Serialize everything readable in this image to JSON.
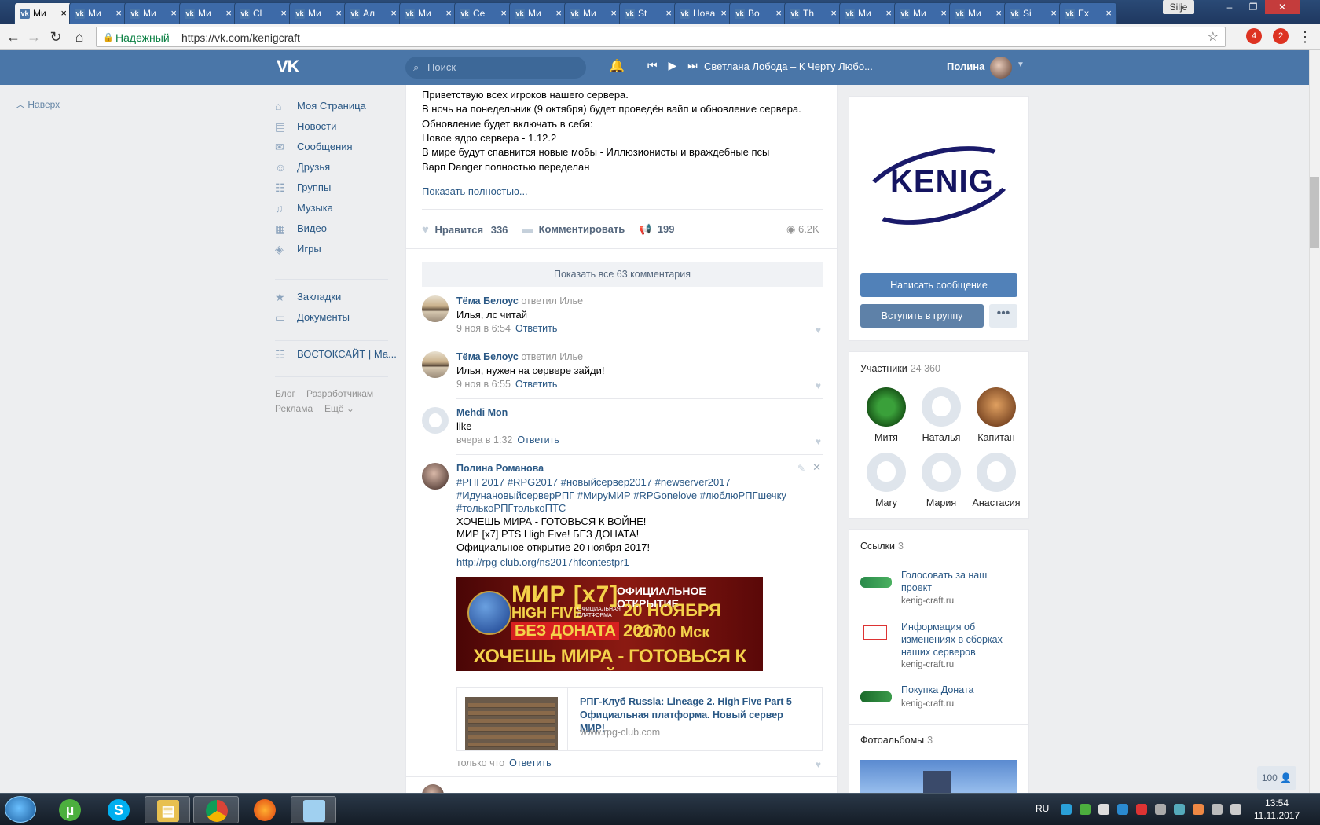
{
  "browser": {
    "tabs": [
      {
        "title": "Ми",
        "active": true
      },
      {
        "title": "Ми"
      },
      {
        "title": "Ми"
      },
      {
        "title": "Ми"
      },
      {
        "title": "Cl"
      },
      {
        "title": "Ми"
      },
      {
        "title": "Ал"
      },
      {
        "title": "Ми"
      },
      {
        "title": "Се"
      },
      {
        "title": "Ми"
      },
      {
        "title": "Ми"
      },
      {
        "title": "St"
      },
      {
        "title": "Новая"
      },
      {
        "title": "Во"
      },
      {
        "title": "Th"
      },
      {
        "title": "Ми"
      },
      {
        "title": "Ми"
      },
      {
        "title": "Ми"
      },
      {
        "title": "Si"
      },
      {
        "title": "Ex"
      }
    ],
    "profile_name": "Silje",
    "secure_label": "Надежный",
    "url": "https://vk.com/kenigcraft",
    "ext_badges": [
      "4",
      "2"
    ]
  },
  "header": {
    "logo": "VK",
    "search_placeholder": "Поиск",
    "track": "Светлана Лобода – К Черту Любо...",
    "user_name": "Полина"
  },
  "left": {
    "up_label": "Наверх",
    "menu": [
      {
        "label": "Моя Страница",
        "icon": "home-icon",
        "glyph": "⌂"
      },
      {
        "label": "Новости",
        "icon": "news-icon",
        "glyph": "▤"
      },
      {
        "label": "Сообщения",
        "icon": "messages-icon",
        "glyph": "✉"
      },
      {
        "label": "Друзья",
        "icon": "friends-icon",
        "glyph": "☺"
      },
      {
        "label": "Группы",
        "icon": "groups-icon",
        "glyph": "☷"
      },
      {
        "label": "Музыка",
        "icon": "music-icon",
        "glyph": "♫"
      },
      {
        "label": "Видео",
        "icon": "video-icon",
        "glyph": "▦"
      },
      {
        "label": "Игры",
        "icon": "games-icon",
        "glyph": "◈"
      }
    ],
    "menu2": [
      {
        "label": "Закладки",
        "icon": "bookmark-icon",
        "glyph": "★"
      },
      {
        "label": "Документы",
        "icon": "documents-icon",
        "glyph": "▭"
      }
    ],
    "menu3": [
      {
        "label": "ВОСТОКСАЙТ | Ма...",
        "icon": "group-icon",
        "glyph": "☷"
      }
    ],
    "footer": {
      "blog": "Блог",
      "dev": "Разработчикам",
      "ads": "Реклама",
      "more": "Ещё ⌄"
    }
  },
  "post": {
    "lines": [
      "Приветствую всех игроков нашего сервера.",
      "В ночь на понедельник (9 октября) будет проведён вайп и обновление сервера.",
      "Обновление будет включать в себя:",
      "Новое ядро сервера - 1.12.2",
      "В мире будут спавнится новые мобы - Иллюзионисты и враждебные псы",
      "Варп Danger полностью переделан"
    ],
    "show_full": "Показать полностью...",
    "like_label": "Нравится",
    "like_count": "336",
    "comment_label": "Комментировать",
    "share_count": "199",
    "views": "6.2K",
    "show_all_comments": "Показать все 63 комментария"
  },
  "comments": [
    {
      "author": "Тёма Белоус",
      "replied": "ответил Илье",
      "text": "Илья, лс читай",
      "time": "9 ноя в 6:54",
      "reply": "Ответить"
    },
    {
      "author": "Тёма Белоус",
      "replied": "ответил Илье",
      "text": "Илья, нужен на сервере зайди!",
      "time": "9 ноя в 6:55",
      "reply": "Ответить"
    },
    {
      "author": "Mehdi Mon",
      "replied": "",
      "text": "like",
      "time": "вчера в 1:32",
      "reply": "Ответить"
    }
  ],
  "my_comment": {
    "author": "Полина Романова",
    "lines": [
      "#РПГ2017 #RPG2017 #новыйсервер2017 #newserver2017",
      "#ИдунановыйсерверРПГ #МируМИР #RPGonelove #люблюРПГшечку",
      "#толькоРПГтолькоПТС",
      "ХОЧЕШЬ МИРА - ГОТОВЬСЯ К ВОЙНЕ!",
      "МИР [x7] PTS High Five! БЕЗ ДОНАТА!",
      "Официальное открытие 20 ноября 2017!"
    ],
    "link": "http://rpg-club.org/ns2017hfcontestpr1",
    "banner": {
      "l1": "МИР [x7]",
      "l2": "HIGH FIVE",
      "l2b": "ОФИЦИАЛЬНАЯ ПЛАТФОРМА",
      "l3": "БЕЗ ДОНАТА",
      "l4": "ОФИЦИАЛЬНОЕ ОТКРЫТИЕ",
      "l5": "20 НОЯБРЯ 2017",
      "l6": "20:00 Мск",
      "l7": "ХОЧЕШЬ МИРА - ГОТОВЬСЯ К ВОЙНЕ"
    },
    "snippet_title": "РПГ-Клуб Russia: Lineage 2. High Five Part 5 Официальная платформа. Новый сервер МИР!",
    "snippet_domain": "www.rpg-club.com",
    "time": "только что",
    "reply": "Ответить"
  },
  "group": {
    "logo_text": "KENIG",
    "write_btn": "Написать сообщение",
    "join_btn": "Вступить в группу",
    "members_label": "Участники",
    "members_count": "24 360",
    "members": [
      {
        "name": "Митя"
      },
      {
        "name": "Наталья"
      },
      {
        "name": "Капитан"
      },
      {
        "name": "Mary"
      },
      {
        "name": "Мария"
      },
      {
        "name": "Анастасия"
      }
    ],
    "links_label": "Ссылки",
    "links_count": "3",
    "links": [
      {
        "title": "Голосовать за наш проект",
        "domain": "kenig-craft.ru"
      },
      {
        "title": "Информация об изменениях в сборках наших серверов",
        "domain": "kenig-craft.ru"
      },
      {
        "title": "Покупка Доната",
        "domain": "kenig-craft.ru"
      }
    ],
    "albums_label": "Фотоальбомы",
    "albums_count": "3"
  },
  "online_count": "100",
  "taskbar": {
    "lang": "RU",
    "time": "13:54",
    "date": "11.11.2017"
  }
}
